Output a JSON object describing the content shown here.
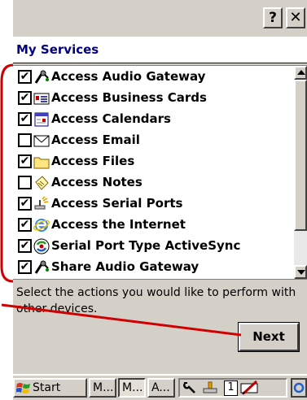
{
  "titlebar": {
    "help_label": "?",
    "close_label": "✕"
  },
  "header": {
    "title": "My Services"
  },
  "services": [
    {
      "label": "Access Audio Gateway",
      "checked": true,
      "icon": "headset-icon"
    },
    {
      "label": "Access Business Cards",
      "checked": true,
      "icon": "business-card-icon"
    },
    {
      "label": "Access Calendars",
      "checked": true,
      "icon": "calendar-icon"
    },
    {
      "label": "Access Email",
      "checked": false,
      "icon": "envelope-icon"
    },
    {
      "label": "Access Files",
      "checked": true,
      "icon": "folder-icon"
    },
    {
      "label": "Access Notes",
      "checked": false,
      "icon": "notes-icon"
    },
    {
      "label": "Access Serial Ports",
      "checked": true,
      "icon": "serial-port-icon"
    },
    {
      "label": "Access the Internet",
      "checked": true,
      "icon": "internet-explorer-icon"
    },
    {
      "label": "Serial Port Type ActiveSync",
      "checked": true,
      "icon": "activesync-icon"
    },
    {
      "label": "Share Audio Gateway",
      "checked": true,
      "icon": "headset-icon"
    }
  ],
  "instruction": "Select the actions you would like to perform with other devices.",
  "next_label": "Next",
  "taskbar": {
    "start_label": "Start",
    "tasks": [
      "M...",
      "M...",
      "A..."
    ],
    "tray_number": "1"
  }
}
